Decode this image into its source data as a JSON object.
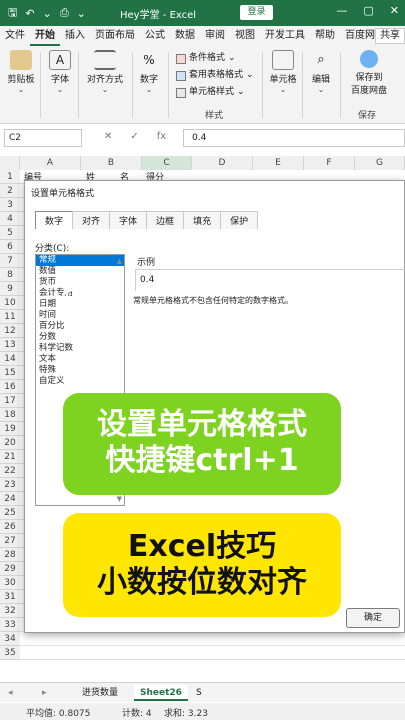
{
  "titlebar": {
    "filename": "Hey学堂",
    "app": "Excel",
    "login_label": "登录",
    "minimize": "—",
    "restore": "▢",
    "close": "✕"
  },
  "tabs": [
    "文件",
    "开始",
    "插入",
    "页面布局",
    "公式",
    "数据",
    "审阅",
    "视图",
    "开发工具",
    "帮助",
    "百度网盘"
  ],
  "share_label": "共享",
  "ribbon": {
    "clipboard": "剪贴板",
    "font": "字体",
    "align": "对齐方式",
    "number": "数字",
    "style_items": [
      "条件格式",
      "套用表格格式",
      "单元格样式"
    ],
    "styles_group": "样式",
    "cells": "单元格",
    "edit": "编辑",
    "save_to": "保存到",
    "baidu": "百度网盘",
    "save_group": "保存"
  },
  "formula": {
    "namebox": "C2",
    "value": "0.4"
  },
  "grid": {
    "columns": [
      "A",
      "B",
      "C",
      "D",
      "E",
      "F",
      "G"
    ],
    "rows": [
      "1",
      "2",
      "3",
      "4",
      "5",
      "6",
      "7",
      "8",
      "9",
      "10",
      "11",
      "12",
      "13",
      "14",
      "15",
      "16",
      "17",
      "18",
      "19",
      "20",
      "21",
      "22",
      "23",
      "24",
      "25",
      "26",
      "27",
      "28",
      "29",
      "30",
      "31",
      "32",
      "33",
      "34",
      "35"
    ],
    "row1": [
      "编号",
      "姓",
      "名",
      "得分"
    ]
  },
  "dialog": {
    "title": "设置单元格格式",
    "tabs": [
      "数字",
      "对齐",
      "字体",
      "边框",
      "填充",
      "保护"
    ],
    "category_label": "分类(C):",
    "categories": [
      "常规",
      "数值",
      "货币",
      "会计专用",
      "日期",
      "时间",
      "百分比",
      "分数",
      "科学记数",
      "文本",
      "特殊",
      "自定义"
    ],
    "sample_label": "示例",
    "sample_value": "0.4",
    "description": "常规单元格格式不包含任何特定的数字格式。",
    "ok": "确定"
  },
  "overlay": {
    "green_line1": "设置单元格格式",
    "green_line2": "快捷键ctrl+1",
    "yellow_line1": "Excel技巧",
    "yellow_line2": "小数按位数对齐"
  },
  "sheets": [
    "进货数量",
    "Sheet26",
    "S"
  ],
  "status": {
    "average": "平均值: 0.8075",
    "count": "计数: 4",
    "sum": "求和: 3.23"
  },
  "colors": {
    "excel_green": "#217346",
    "banner_green": "#7ed321",
    "banner_yellow": "#ffe600"
  }
}
